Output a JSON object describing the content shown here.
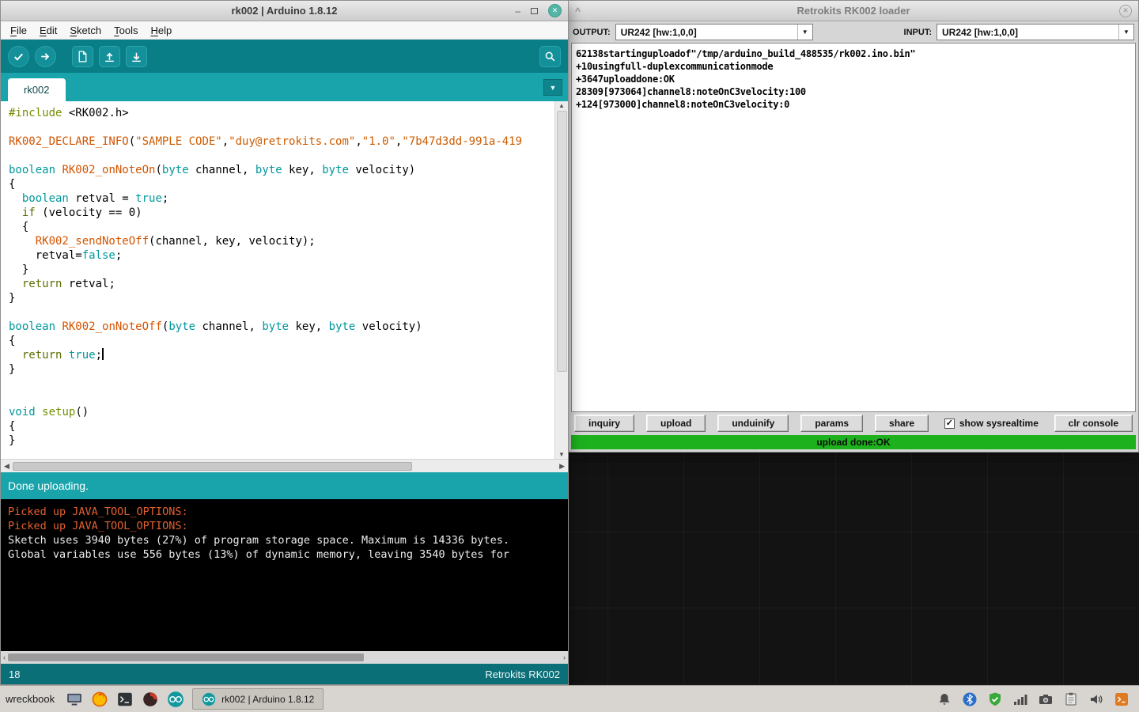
{
  "arduino": {
    "window_title": "rk002 | Arduino 1.8.12",
    "menu": [
      {
        "label": "File"
      },
      {
        "label": "Edit"
      },
      {
        "label": "Sketch"
      },
      {
        "label": "Tools"
      },
      {
        "label": "Help"
      }
    ],
    "toolbar_icons": [
      "verify-icon",
      "upload-icon",
      "new-sketch-icon",
      "open-icon",
      "save-icon",
      "serial-monitor-icon"
    ],
    "tab_label": "rk002",
    "code_lines": [
      [
        {
          "t": "#include",
          "c": "pre"
        },
        {
          "t": " <RK002.h>",
          "c": "pln"
        }
      ],
      [],
      [
        {
          "t": "RK002_DECLARE_INFO",
          "c": "fn"
        },
        {
          "t": "(",
          "c": "pln"
        },
        {
          "t": "\"SAMPLE CODE\"",
          "c": "str"
        },
        {
          "t": ",",
          "c": "pln"
        },
        {
          "t": "\"duy@retrokits.com\"",
          "c": "str"
        },
        {
          "t": ",",
          "c": "pln"
        },
        {
          "t": "\"1.0\"",
          "c": "str"
        },
        {
          "t": ",",
          "c": "pln"
        },
        {
          "t": "\"7b47d3dd-991a-419",
          "c": "str"
        }
      ],
      [],
      [
        {
          "t": "boolean",
          "c": "typ"
        },
        {
          "t": " ",
          "c": "pln"
        },
        {
          "t": "RK002_onNoteOn",
          "c": "fn"
        },
        {
          "t": "(",
          "c": "pln"
        },
        {
          "t": "byte",
          "c": "typ"
        },
        {
          "t": " channel, ",
          "c": "pln"
        },
        {
          "t": "byte",
          "c": "typ"
        },
        {
          "t": " key, ",
          "c": "pln"
        },
        {
          "t": "byte",
          "c": "typ"
        },
        {
          "t": " velocity)",
          "c": "pln"
        }
      ],
      [
        {
          "t": "{",
          "c": "pln"
        }
      ],
      [
        {
          "t": "  ",
          "c": "pln"
        },
        {
          "t": "boolean",
          "c": "typ"
        },
        {
          "t": " retval = ",
          "c": "pln"
        },
        {
          "t": "true",
          "c": "typ"
        },
        {
          "t": ";",
          "c": "pln"
        }
      ],
      [
        {
          "t": "  ",
          "c": "pln"
        },
        {
          "t": "if",
          "c": "kw"
        },
        {
          "t": " (velocity == 0)",
          "c": "pln"
        }
      ],
      [
        {
          "t": "  {",
          "c": "pln"
        }
      ],
      [
        {
          "t": "    ",
          "c": "pln"
        },
        {
          "t": "RK002_sendNoteOff",
          "c": "fn"
        },
        {
          "t": "(channel, key, velocity);",
          "c": "pln"
        }
      ],
      [
        {
          "t": "    retval=",
          "c": "pln"
        },
        {
          "t": "false",
          "c": "typ"
        },
        {
          "t": ";",
          "c": "pln"
        }
      ],
      [
        {
          "t": "  }",
          "c": "pln"
        }
      ],
      [
        {
          "t": "  ",
          "c": "pln"
        },
        {
          "t": "return",
          "c": "kw"
        },
        {
          "t": " retval;",
          "c": "pln"
        }
      ],
      [
        {
          "t": "}",
          "c": "pln"
        }
      ],
      [],
      [
        {
          "t": "boolean",
          "c": "typ"
        },
        {
          "t": " ",
          "c": "pln"
        },
        {
          "t": "RK002_onNoteOff",
          "c": "fn"
        },
        {
          "t": "(",
          "c": "pln"
        },
        {
          "t": "byte",
          "c": "typ"
        },
        {
          "t": " channel, ",
          "c": "pln"
        },
        {
          "t": "byte",
          "c": "typ"
        },
        {
          "t": " key, ",
          "c": "pln"
        },
        {
          "t": "byte",
          "c": "typ"
        },
        {
          "t": " velocity)",
          "c": "pln"
        }
      ],
      [
        {
          "t": "{",
          "c": "pln"
        }
      ],
      [
        {
          "t": "  ",
          "c": "pln"
        },
        {
          "t": "return",
          "c": "kw"
        },
        {
          "t": " ",
          "c": "pln"
        },
        {
          "t": "true",
          "c": "typ"
        },
        {
          "t": ";",
          "c": "pln",
          "caret": true
        }
      ],
      [
        {
          "t": "}",
          "c": "pln"
        }
      ],
      [],
      [],
      [
        {
          "t": "void",
          "c": "typ"
        },
        {
          "t": " ",
          "c": "pln"
        },
        {
          "t": "setup",
          "c": "fn2"
        },
        {
          "t": "()",
          "c": "pln"
        }
      ],
      [
        {
          "t": "{",
          "c": "pln"
        }
      ],
      [
        {
          "t": "}",
          "c": "pln"
        }
      ]
    ],
    "status_text": "Done uploading.",
    "console_lines": [
      {
        "text": "Picked up JAVA_TOOL_OPTIONS: ",
        "type": "err"
      },
      {
        "text": "Picked up JAVA_TOOL_OPTIONS: ",
        "type": "err"
      },
      {
        "text": "Sketch uses 3940 bytes (27%) of program storage space. Maximum is 14336 bytes.",
        "type": "out"
      },
      {
        "text": "Global variables use 556 bytes (13%) of dynamic memory, leaving 3540 bytes for",
        "type": "out"
      }
    ],
    "line_number": "18",
    "board_name": "Retrokits RK002"
  },
  "loader": {
    "window_title": "Retrokits RK002 loader",
    "output_label": "OUTPUT:",
    "output_value": "UR242 [hw:1,0,0]",
    "input_label": "INPUT:",
    "input_value": "UR242 [hw:1,0,0]",
    "console_lines": [
      "62138startinguploadof\"/tmp/arduino_build_488535/rk002.ino.bin\"",
      "+10usingfull-duplexcommunicationmode",
      "+3647uploaddone:OK",
      "28309[973064]channel8:noteOnC3velocity:100",
      "+124[973000]channel8:noteOnC3velocity:0"
    ],
    "buttons": [
      "inquiry",
      "upload",
      "unduinify",
      "params",
      "share"
    ],
    "sysrealtime_label": "show sysrealtime",
    "sysrealtime_checked": true,
    "clr_button": "clr console",
    "status_text": "upload done:OK"
  },
  "taskbar": {
    "launcher_label": "wreckbook",
    "launchers": [
      "display",
      "firefox",
      "terminal-dark",
      "browser-dark",
      "arduino"
    ],
    "task_button": "rk002 | Arduino 1.8.12",
    "tray_icons": [
      "notification-bell",
      "bluetooth",
      "shield-check",
      "network-signal",
      "screenshot-camera",
      "clipboard",
      "volume",
      "terminal-orange"
    ]
  },
  "colors": {
    "arduino_toolbar": "#0a7e87",
    "arduino_header": "#18a4aa",
    "arduino_linestatus": "#0b6f77",
    "console_error": "#e2602e",
    "loader_status_green": "#1db21d"
  }
}
